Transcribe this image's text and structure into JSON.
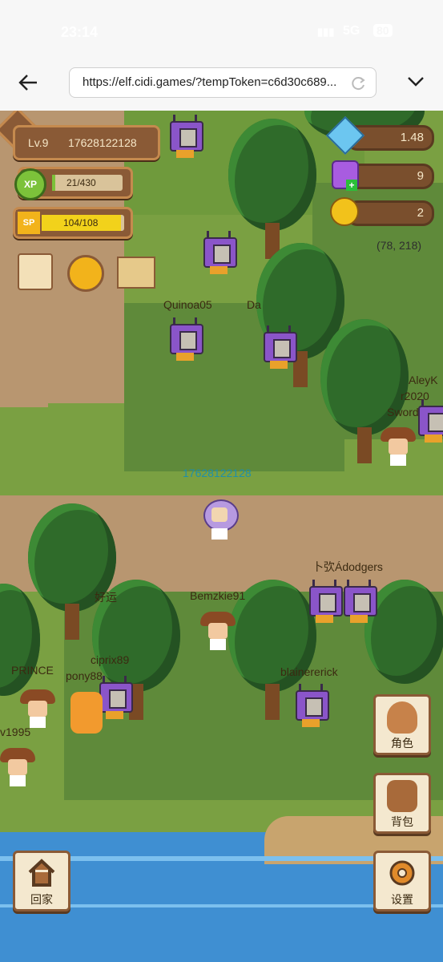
{
  "status": {
    "time": "23:14",
    "network": "5G",
    "battery": "80"
  },
  "browser": {
    "url": "https://elf.cidi.games/?tempToken=c6d30c689..."
  },
  "hud": {
    "level": "Lv.9",
    "player_id": "17628122128",
    "xp_badge": "XP",
    "xp": "21/430",
    "xp_fill": 0.05,
    "sp_badge": "SP",
    "sp": "104/108",
    "sp_fill": 0.96,
    "diamond": "1.48",
    "gem": "9",
    "coin": "2",
    "coords": "(78, 218)"
  },
  "players": {
    "self": "17628122128",
    "names": [
      "Quinoa05",
      "Da",
      "AleyK",
      "r2020",
      "Sword",
      "卜弞Ádodgers",
      "好运",
      "Bemzkie91",
      "ciprix89",
      "PRINCE",
      "pony88",
      "blainererick",
      "v1995"
    ]
  },
  "buttons": {
    "character": "角色",
    "bag": "背包",
    "home": "回家",
    "settings": "设置"
  },
  "colors": {
    "grass": "#7aa042",
    "dark_grass": "#5f8a3a",
    "path": "#b89670",
    "water": "#3f8fd2",
    "sp_bar": "#f2d21b",
    "xp_bar": "#7cc23a"
  }
}
